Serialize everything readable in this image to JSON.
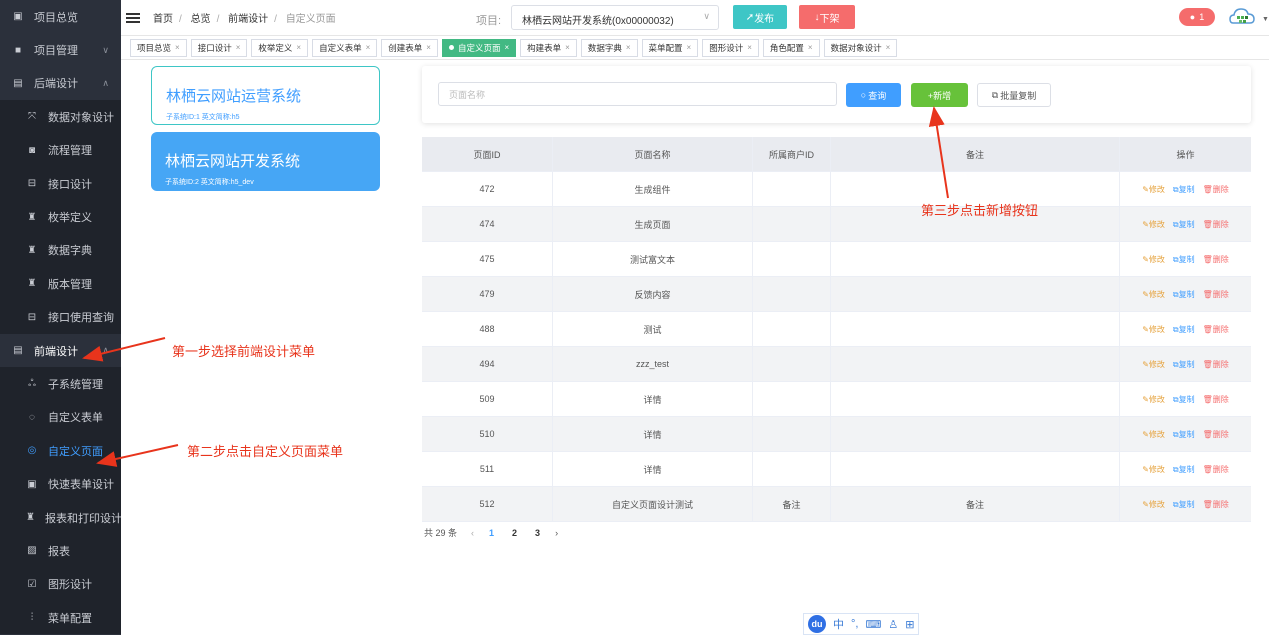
{
  "sidebar": {
    "items": [
      {
        "label": "项目总览",
        "icon": "edit-icon",
        "kind": "top"
      },
      {
        "label": "项目管理",
        "icon": "folder-icon",
        "kind": "top",
        "arrow": "∨"
      },
      {
        "label": "后端设计",
        "icon": "server-icon",
        "kind": "top",
        "arrow": "∧"
      },
      {
        "label": "数据对象设计",
        "icon": "object-icon",
        "kind": "sub"
      },
      {
        "label": "流程管理",
        "icon": "flow-icon",
        "kind": "sub"
      },
      {
        "label": "接口设计",
        "icon": "api-icon",
        "kind": "sub"
      },
      {
        "label": "枚举定义",
        "icon": "enum-icon",
        "kind": "sub"
      },
      {
        "label": "数据字典",
        "icon": "dictionary-icon",
        "kind": "sub"
      },
      {
        "label": "版本管理",
        "icon": "version-icon",
        "kind": "sub"
      },
      {
        "label": "接口使用查询",
        "icon": "search-api-icon",
        "kind": "sub"
      },
      {
        "label": "前端设计",
        "icon": "frontend-icon",
        "kind": "top",
        "arrow": "∧"
      },
      {
        "label": "子系统管理",
        "icon": "subsystem-icon",
        "kind": "sub"
      },
      {
        "label": "自定义表单",
        "icon": "form-icon",
        "kind": "sub"
      },
      {
        "label": "自定义页面",
        "icon": "page-icon",
        "kind": "sub",
        "active": true
      },
      {
        "label": "快速表单设计",
        "icon": "quick-form-icon",
        "kind": "sub"
      },
      {
        "label": "报表和打印设计",
        "icon": "print-icon",
        "kind": "sub"
      },
      {
        "label": "报表",
        "icon": "report-icon",
        "kind": "sub"
      },
      {
        "label": "图形设计",
        "icon": "graph-icon",
        "kind": "sub"
      },
      {
        "label": "菜单配置",
        "icon": "menu-icon",
        "kind": "sub"
      }
    ]
  },
  "header": {
    "breadcrumb": [
      "首页",
      "总览",
      "前端设计",
      "自定义页面"
    ],
    "project_label": "项目:",
    "project_value": "林栖云网站开发系统(0x00000032)",
    "publish_label": "发布",
    "offline_label": "下架",
    "notification_count": "1"
  },
  "tabs": [
    {
      "label": "项目总览"
    },
    {
      "label": "接口设计"
    },
    {
      "label": "枚举定义"
    },
    {
      "label": "自定义表单"
    },
    {
      "label": "创建表单"
    },
    {
      "label": "自定义页面",
      "active": true
    },
    {
      "label": "构建表单"
    },
    {
      "label": "数据字典"
    },
    {
      "label": "菜单配置"
    },
    {
      "label": "图形设计"
    },
    {
      "label": "角色配置"
    },
    {
      "label": "数据对象设计"
    }
  ],
  "systems": [
    {
      "name": "林栖云网站运营系统",
      "meta": "子系统ID:1    英文简称:h5"
    },
    {
      "name": "林栖云网站开发系统",
      "meta": "子系统ID:2    英文简称:h5_dev"
    }
  ],
  "search": {
    "placeholder": "页面名称",
    "query_label": "查询",
    "add_label": "+新增",
    "batch_copy_label": "批量复制"
  },
  "table": {
    "headers": [
      "页面ID",
      "页面名称",
      "所属商户ID",
      "备注",
      "操作"
    ],
    "rows": [
      {
        "id": "472",
        "name": "生成组件",
        "tenant": "",
        "note": ""
      },
      {
        "id": "474",
        "name": "生成页面",
        "tenant": "",
        "note": ""
      },
      {
        "id": "475",
        "name": "测试富文本",
        "tenant": "",
        "note": ""
      },
      {
        "id": "479",
        "name": "反馈内容",
        "tenant": "",
        "note": ""
      },
      {
        "id": "488",
        "name": "测试",
        "tenant": "",
        "note": ""
      },
      {
        "id": "494",
        "name": "zzz_test",
        "tenant": "",
        "note": ""
      },
      {
        "id": "509",
        "name": "详情",
        "tenant": "",
        "note": ""
      },
      {
        "id": "510",
        "name": "详情",
        "tenant": "",
        "note": ""
      },
      {
        "id": "511",
        "name": "详情",
        "tenant": "",
        "note": ""
      },
      {
        "id": "512",
        "name": "自定义页面设计测试",
        "tenant": "备注",
        "note": "备注"
      }
    ],
    "actions": {
      "edit": "修改",
      "copy": "复制",
      "delete": "删除"
    }
  },
  "pager": {
    "total": "共 29 条",
    "pages": [
      "1",
      "2",
      "3"
    ],
    "current": "1"
  },
  "annotations": {
    "step1": "第一步选择前端设计菜单",
    "step2": "第二步点击自定义页面菜单",
    "step3": "第三步点击新增按钮"
  },
  "ime": {
    "logo": "du",
    "lang": "中"
  },
  "colors": {
    "sidebar_bg": "#2b303b",
    "accent": "#409eff",
    "add_green": "#67c23a",
    "publish": "#3ec6c6",
    "offline": "#f56c6c",
    "annotation_red": "#e8341c"
  }
}
